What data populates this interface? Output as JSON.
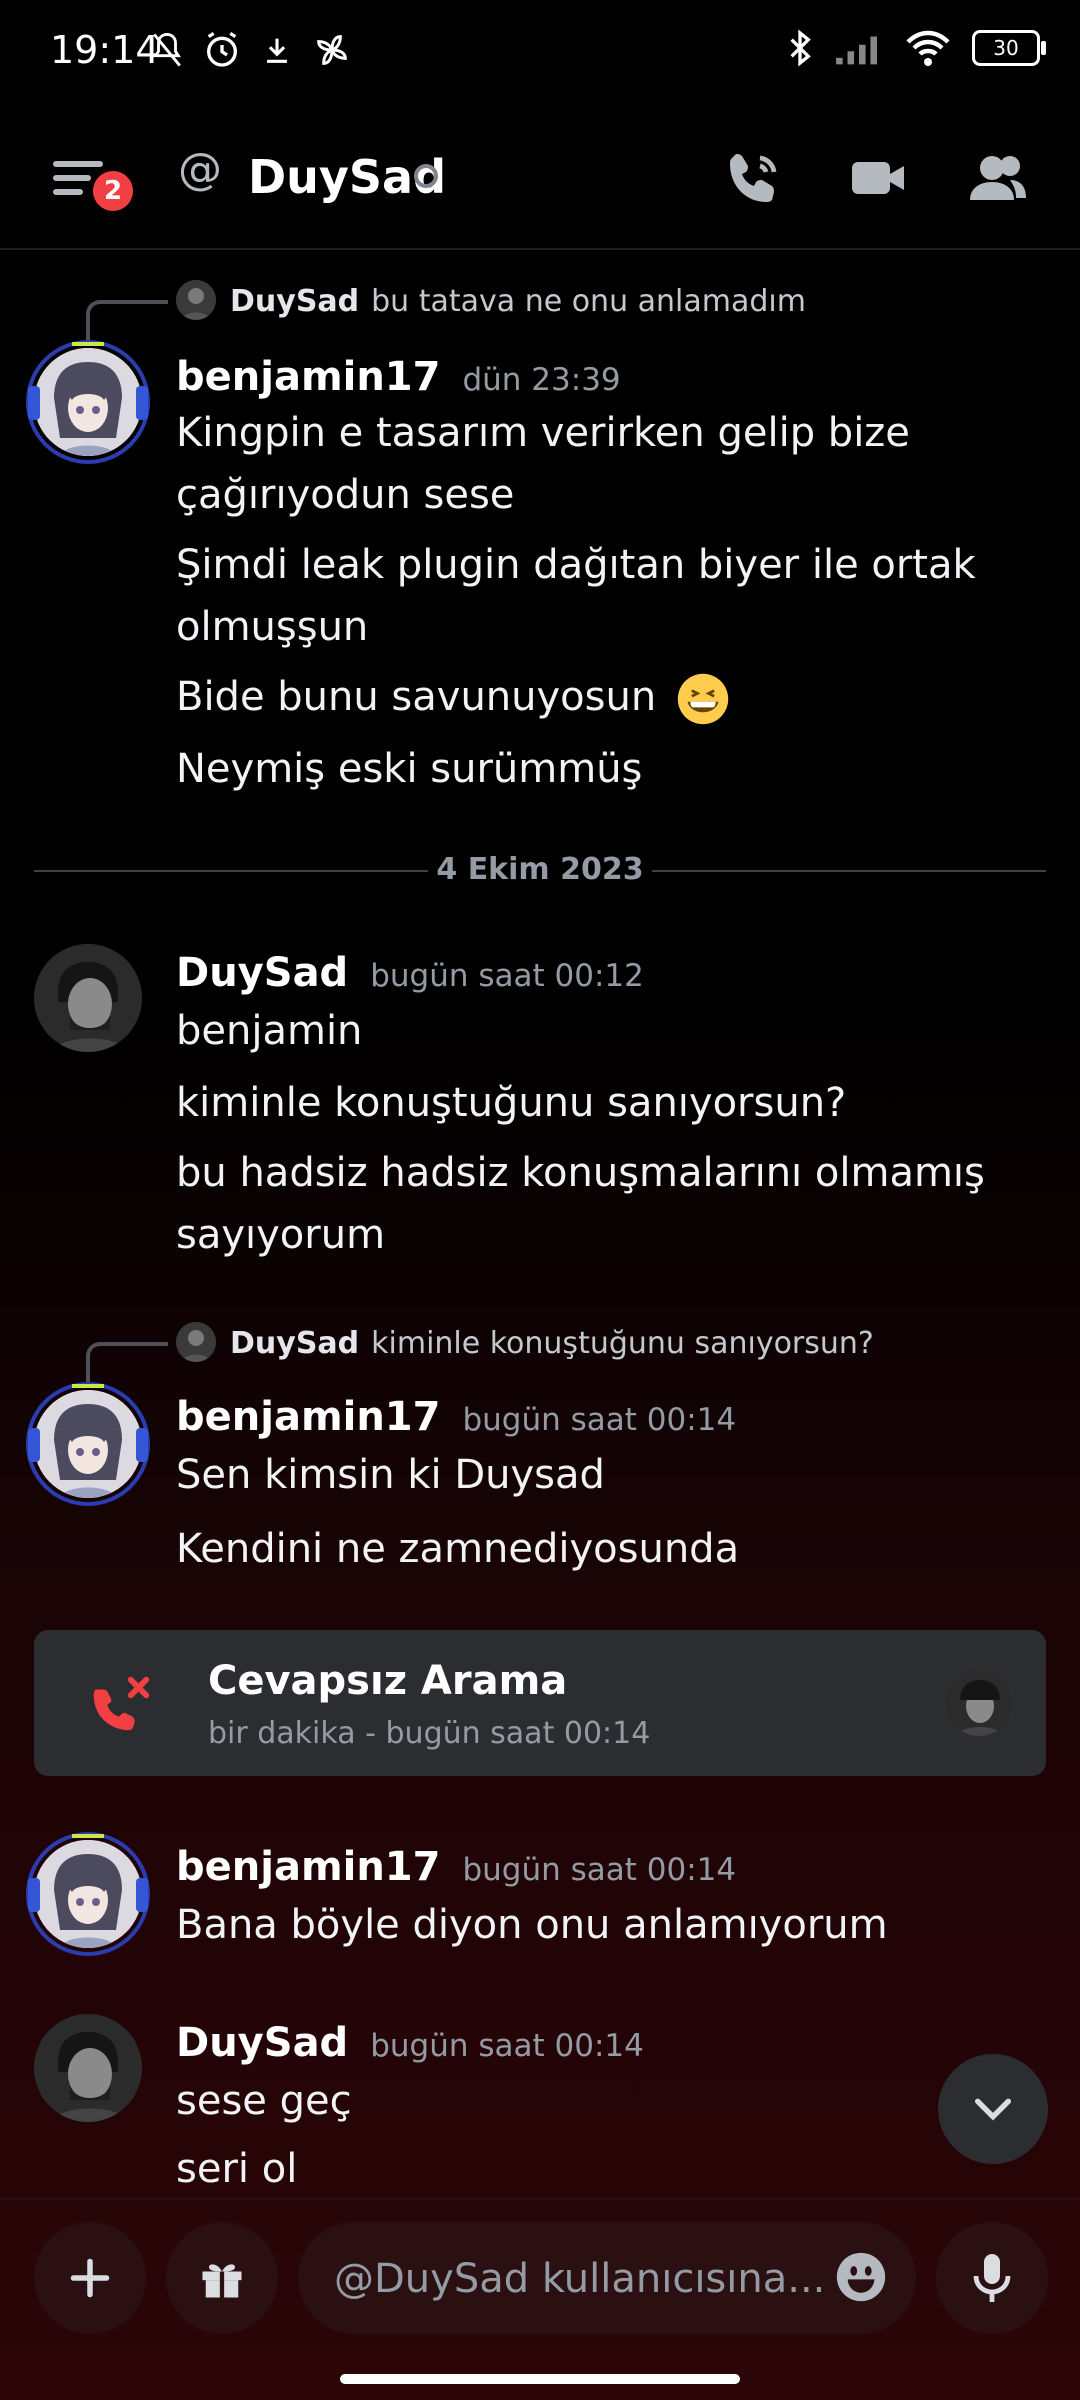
{
  "status_bar": {
    "time": "19:14",
    "battery": "30"
  },
  "header": {
    "channel_name": "DuySad",
    "unread_badge": "2"
  },
  "messages": [
    {
      "reply": {
        "author": "DuySad",
        "text": "bu tatava ne onu anlamadım"
      },
      "author": "benjamin17",
      "time": "dün 23:39",
      "lines": [
        "Kingpin e tasarım verirken gelip bize",
        "çağırıyodun sese",
        "Şimdi leak plugin dağıtan biyer ile ortak",
        "olmuşşun",
        "Bide bunu savunuyosun",
        "Neymiş eski surümmüş"
      ]
    },
    {
      "author": "DuySad",
      "time": "bugün saat 00:12",
      "lines": [
        "benjamin",
        "kiminle konuştuğunu sanıyorsun?",
        "bu hadsiz hadsiz konuşmalarını olmamış",
        "sayıyorum"
      ]
    },
    {
      "reply": {
        "author": "DuySad",
        "text": "kiminle konuştuğunu sanıyorsun?"
      },
      "author": "benjamin17",
      "time": "bugün saat 00:14",
      "lines": [
        "Sen kimsin ki Duysad",
        "Kendini ne zamnediyosunda"
      ]
    },
    {
      "author": "benjamin17",
      "time": "bugün saat 00:14",
      "lines": [
        "Bana böyle diyon onu anlamıyorum"
      ]
    },
    {
      "author": "DuySad",
      "time": "bugün saat 00:14",
      "lines": [
        "sese geç",
        "seri ol"
      ]
    }
  ],
  "date_divider": "4 Ekim 2023",
  "missed_call": {
    "title": "Cevapsız Arama",
    "subtitle": "bir dakika - bugün saat 00:14"
  },
  "composer": {
    "placeholder": "@DuySad kullanıcısına..."
  },
  "icons": {
    "menu": "hamburger-menu-icon",
    "at": "at-icon",
    "call": "phone-call-icon",
    "video": "video-camera-icon",
    "members": "members-icon",
    "missed_call": "missed-call-icon",
    "jump": "chevron-down-icon",
    "add": "plus-icon",
    "gift": "gift-icon",
    "emoji": "emoji-icon",
    "mic": "microphone-icon",
    "grin_emoji": "grinning-face-emoji"
  },
  "colors": {
    "badge": "#f23f43",
    "missed_call_red": "#f23f43",
    "card_bg": "#2b2d31"
  }
}
